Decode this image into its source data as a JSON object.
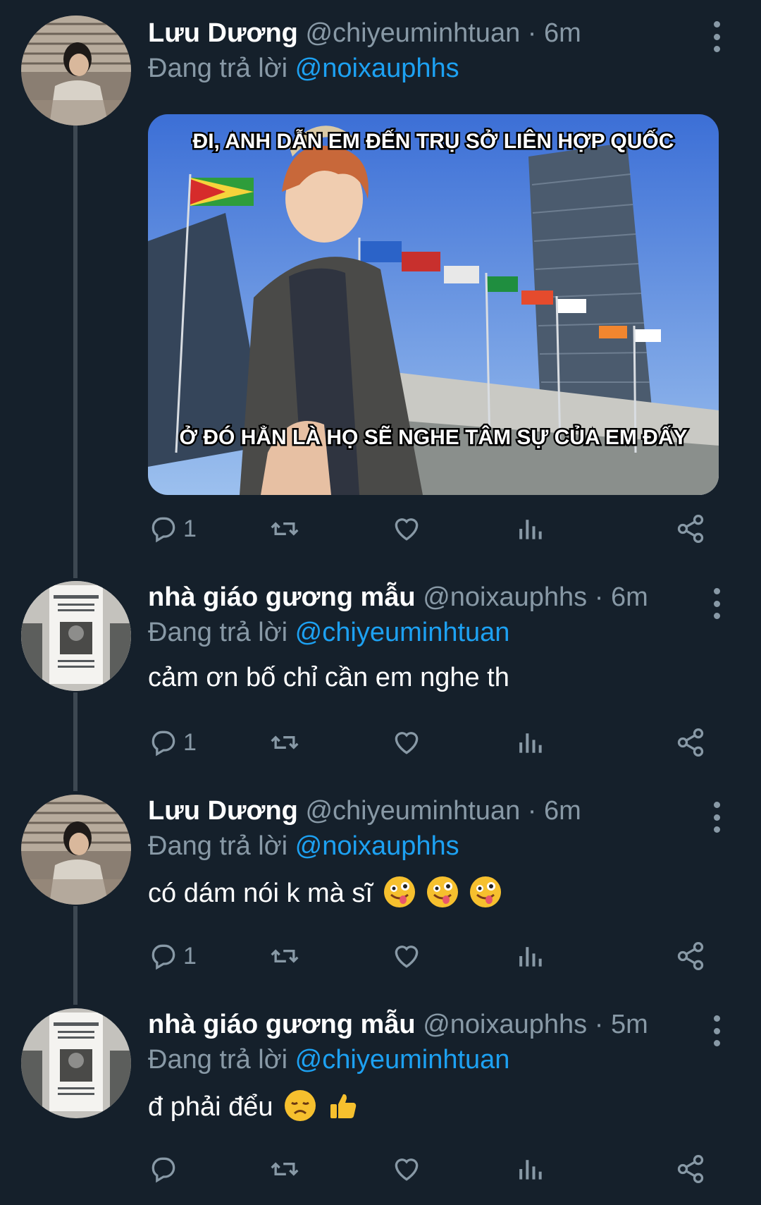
{
  "colors": {
    "background": "#15202b",
    "text_primary": "#ffffff",
    "text_secondary": "#8899a6",
    "link": "#1da1f2",
    "thread_line": "#3d4852"
  },
  "tweets": [
    {
      "name": "Lưu Dương",
      "handle": "@chiyeuminhtuan",
      "separator": "·",
      "time": "6m",
      "reply_prefix": "Đang trả lời",
      "reply_to": "@noixauphhs",
      "text": "",
      "media": {
        "caption_top": "ĐI, ANH DẪN EM ĐẾN TRỤ SỞ LIÊN HỢP QUỐC",
        "caption_bottom": "Ở ĐÓ HẲN LÀ HỌ SẼ NGHE TÂM SỰ CỦA EM ĐẤY"
      },
      "reply_count": "1",
      "icons": [
        "reply-icon",
        "retweet-icon",
        "like-icon",
        "analytics-icon",
        "share-icon"
      ]
    },
    {
      "name": "nhà giáo gương mẫu",
      "handle": "@noixauphhs",
      "separator": "·",
      "time": "6m",
      "reply_prefix": "Đang trả lời",
      "reply_to": "@chiyeuminhtuan",
      "text": "cảm ơn bố chỉ cần em nghe th",
      "reply_count": "1"
    },
    {
      "name": "Lưu Dương",
      "handle": "@chiyeuminhtuan",
      "separator": "·",
      "time": "6m",
      "reply_prefix": "Đang trả lời",
      "reply_to": "@noixauphhs",
      "text": "có dám nói k mà sĩ",
      "emojis": [
        "zany-face-emoji",
        "zany-face-emoji",
        "zany-face-emoji"
      ],
      "reply_count": "1"
    },
    {
      "name": "nhà giáo gương mẫu",
      "handle": "@noixauphhs",
      "separator": "·",
      "time": "5m",
      "reply_prefix": "Đang trả lời",
      "reply_to": "@chiyeuminhtuan",
      "text": "đ phải đểu",
      "emojis": [
        "disappointed-face-emoji",
        "thumbs-up-emoji"
      ],
      "reply_count": ""
    }
  ]
}
